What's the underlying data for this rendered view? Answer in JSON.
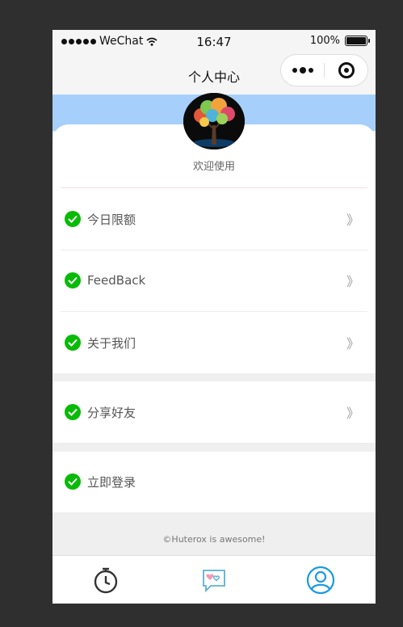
{
  "status_bar": {
    "carrier": "WeChat",
    "time": "16:47",
    "battery": "100%"
  },
  "navbar": {
    "title": "个人中心"
  },
  "profile": {
    "welcome": "欢迎使用"
  },
  "menu": {
    "items": [
      {
        "label": "今日限额",
        "chevron": "》"
      },
      {
        "label": "FeedBack",
        "chevron": "》"
      },
      {
        "label": "关于我们",
        "chevron": "》"
      }
    ],
    "share": {
      "label": "分享好友",
      "chevron": "》"
    },
    "login": {
      "label": "立即登录"
    }
  },
  "footer": {
    "text": "©Huterox is awesome!"
  },
  "tabbar": {
    "icons": [
      "timer-icon",
      "chat-heart-icon",
      "user-icon"
    ]
  },
  "colors": {
    "accent": "#09bb07",
    "banner": "#a6d0fb",
    "tab_active": "#1a9be0"
  }
}
